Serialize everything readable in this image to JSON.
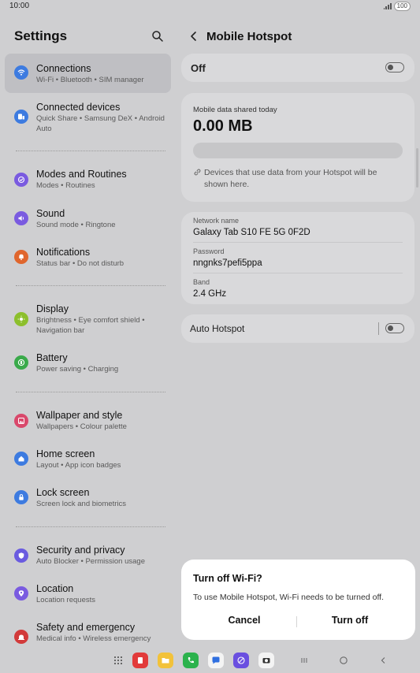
{
  "status": {
    "time": "10:00",
    "battery": "100"
  },
  "settings": {
    "title": "Settings",
    "items": [
      {
        "title": "Connections",
        "subtitle": "Wi-Fi  •  Bluetooth  •  SIM manager",
        "icon": "wifi-icon",
        "color": "#3d7be0"
      },
      {
        "title": "Connected devices",
        "subtitle": "Quick Share  •  Samsung DeX  •  Android Auto",
        "icon": "devices-icon",
        "color": "#3d7be0"
      },
      {
        "title": "Modes and Routines",
        "subtitle": "Modes  •  Routines",
        "icon": "modes-icon",
        "color": "#7a5be0"
      },
      {
        "title": "Sound",
        "subtitle": "Sound mode  •  Ringtone",
        "icon": "sound-icon",
        "color": "#7a5be0"
      },
      {
        "title": "Notifications",
        "subtitle": "Status bar  •  Do not disturb",
        "icon": "bell-icon",
        "color": "#e0662d"
      },
      {
        "title": "Display",
        "subtitle": "Brightness  •  Eye comfort shield  •  Navigation bar",
        "icon": "sun-icon",
        "color": "#8cbf2c"
      },
      {
        "title": "Battery",
        "subtitle": "Power saving  •  Charging",
        "icon": "battery-icon",
        "color": "#3aaa4a"
      },
      {
        "title": "Wallpaper and style",
        "subtitle": "Wallpapers  •  Colour palette",
        "icon": "wallpaper-icon",
        "color": "#d9486b"
      },
      {
        "title": "Home screen",
        "subtitle": "Layout  •  App icon badges",
        "icon": "home-icon",
        "color": "#3d7be0"
      },
      {
        "title": "Lock screen",
        "subtitle": "Screen lock and biometrics",
        "icon": "lock-icon",
        "color": "#3d7be0"
      },
      {
        "title": "Security and privacy",
        "subtitle": "Auto Blocker  •  Permission usage",
        "icon": "shield-icon",
        "color": "#6a5be0"
      },
      {
        "title": "Location",
        "subtitle": "Location requests",
        "icon": "location-icon",
        "color": "#7a5be0"
      },
      {
        "title": "Safety and emergency",
        "subtitle": "Medical info  •  Wireless emergency",
        "icon": "emergency-icon",
        "color": "#d23a3a"
      }
    ]
  },
  "hotspot": {
    "title": "Mobile Hotspot",
    "state_label": "Off",
    "data_label": "Mobile data shared today",
    "data_value": "0.00 MB",
    "data_used_fraction": 0,
    "note": "Devices that use data from your Hotspot will be shown here.",
    "network_label": "Network name",
    "network_value": "Galaxy Tab S10 FE 5G 0F2D",
    "password_label": "Password",
    "password_value": "nngnks7pefi5ppa",
    "band_label": "Band",
    "band_value": "2.4 GHz",
    "auto_label": "Auto Hotspot"
  },
  "dialog": {
    "title": "Turn off Wi-Fi?",
    "message": "To use Mobile Hotspot, Wi-Fi needs to be turned off.",
    "cancel": "Cancel",
    "confirm": "Turn off"
  },
  "taskbar": {
    "apps": [
      {
        "name": "apps-grid-icon",
        "color": "transparent"
      },
      {
        "name": "notes-app-icon",
        "color": "#e23a3a"
      },
      {
        "name": "files-app-icon",
        "color": "#f2c23a"
      },
      {
        "name": "phone-app-icon",
        "color": "#2bb24c"
      },
      {
        "name": "messages-app-icon",
        "color": "#2f6fe0"
      },
      {
        "name": "internet-app-icon",
        "color": "#6a4fe0"
      },
      {
        "name": "camera-app-icon",
        "color": "#f4f4f4"
      }
    ]
  }
}
